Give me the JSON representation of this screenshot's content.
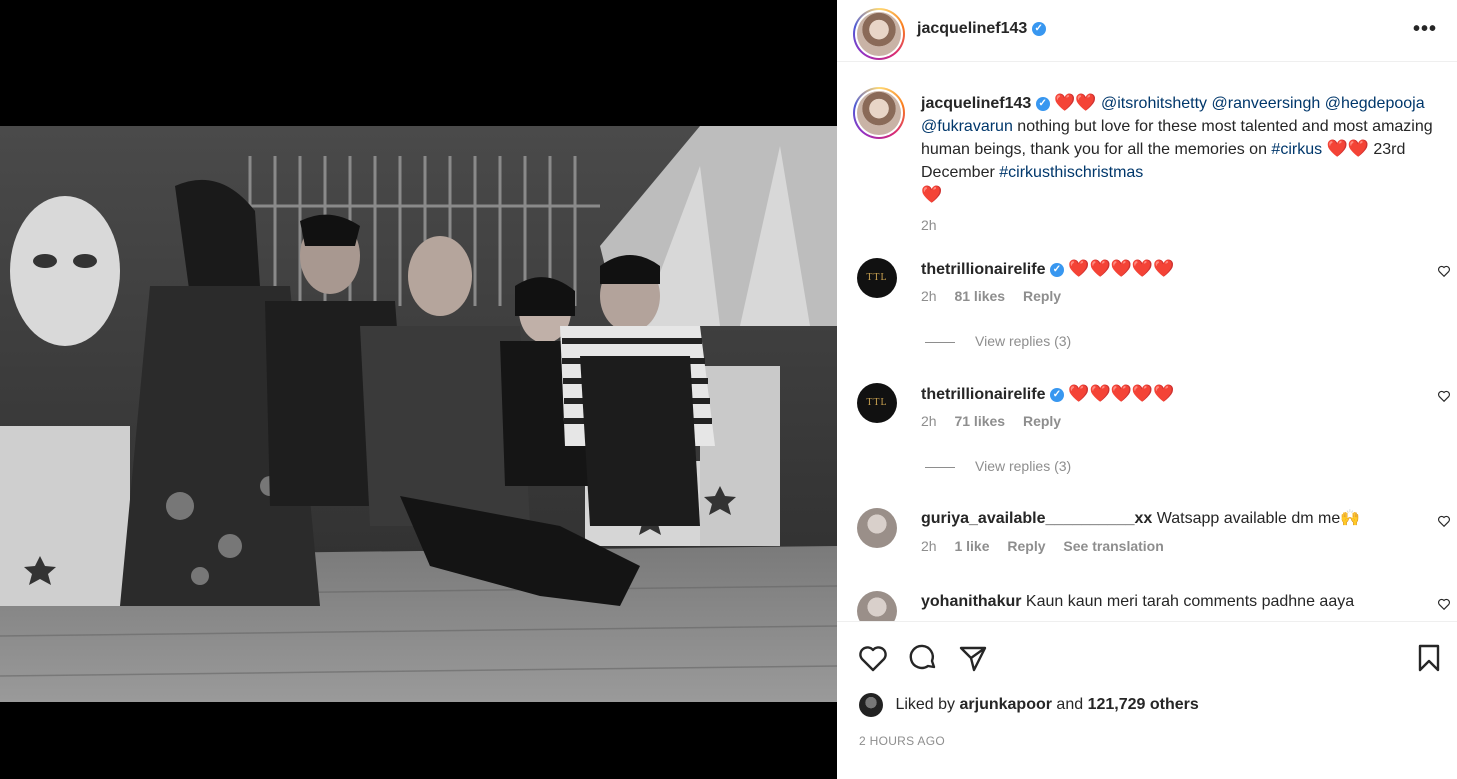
{
  "post": {
    "username": "jacquelinef143",
    "verified_symbol": "✓",
    "more_label": "•••",
    "caption": {
      "hearts_1": "❤️❤️",
      "mention_1": "@itsrohitshetty",
      "mention_2": "@ranveersingh",
      "mention_3": "@hegdepooja",
      "mention_4": "@fukravarun",
      "text_1": "nothing but love for these most talented and most amazing human beings, thank you for all the memories on",
      "hashtag_1": "#cirkus",
      "hearts_2": "❤️❤️",
      "text_2": "23rd December",
      "hashtag_2": "#cirkusthischristmas",
      "hearts_3": "❤️",
      "time": "2h"
    }
  },
  "comments": [
    {
      "username": "thetrillionairelife",
      "verified": true,
      "avatar_text": "TTL",
      "text": "❤️❤️❤️❤️❤️",
      "time": "2h",
      "likes": "81 likes",
      "reply": "Reply",
      "view_replies": "View replies (3)"
    },
    {
      "username": "thetrillionairelife",
      "verified": true,
      "avatar_text": "TTL",
      "text": "❤️❤️❤️❤️❤️",
      "time": "2h",
      "likes": "71 likes",
      "reply": "Reply",
      "view_replies": "View replies (3)"
    },
    {
      "username": "guriya_available__________xx",
      "text": "Watsapp available dm me🙌",
      "time": "2h",
      "likes": "1 like",
      "reply": "Reply",
      "translation": "See translation"
    },
    {
      "username": "yohanithakur",
      "text": "Kaun kaun meri tarah comments padhne aaya"
    }
  ],
  "footer": {
    "liked_by_prefix": "Liked by",
    "liked_by_user": "arjunkapoor",
    "liked_by_and": "and",
    "liked_by_count": "121,729 others",
    "timestamp": "2 HOURS AGO"
  },
  "icons": {
    "like": "heart-icon",
    "comment": "comment-icon",
    "share": "send-icon",
    "save": "bookmark-icon"
  }
}
